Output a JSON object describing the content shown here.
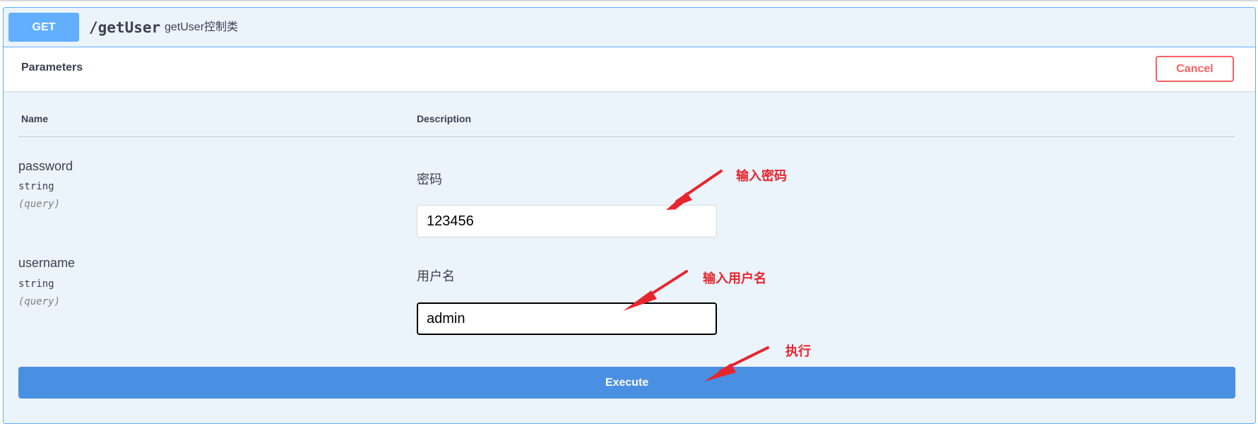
{
  "operation": {
    "method": "GET",
    "path": "/getUser",
    "summary": "getUser控制类"
  },
  "parameters_header": {
    "title": "Parameters",
    "cancel_label": "Cancel"
  },
  "table": {
    "col_name": "Name",
    "col_description": "Description"
  },
  "params": [
    {
      "name": "password",
      "type": "string",
      "in": "(query)",
      "description": "密码",
      "value": "123456"
    },
    {
      "name": "username",
      "type": "string",
      "in": "(query)",
      "description": "用户名",
      "value": "admin"
    }
  ],
  "execute_label": "Execute",
  "annotations": {
    "password": "输入密码",
    "username": "输入用户名",
    "execute": "执行"
  },
  "colors": {
    "get_accent": "#61affe",
    "block_bg": "#ebf3fb",
    "cancel": "#ff6060",
    "execute": "#4990e2",
    "annotation": "#e6262e"
  }
}
